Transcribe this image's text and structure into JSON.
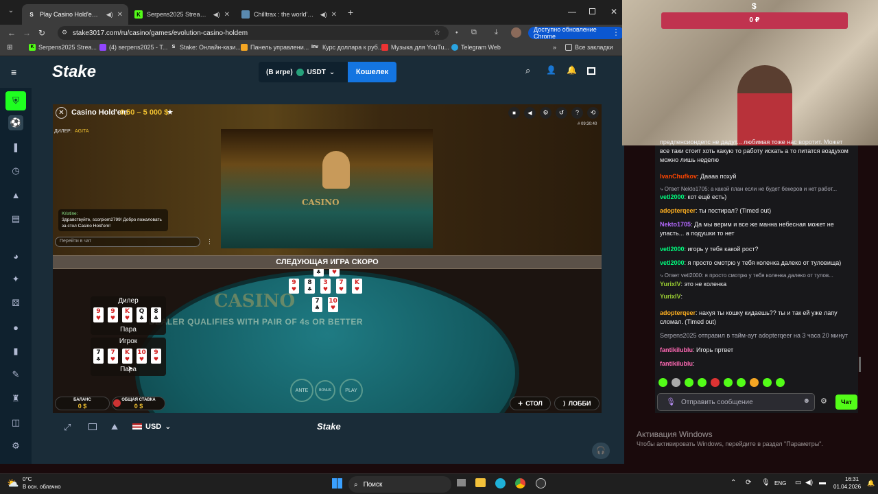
{
  "browser": {
    "tabs": [
      {
        "title": "Play Casino Hold'em by Evo",
        "active": true
      },
      {
        "title": "Serpens2025 Stream - Watch L",
        "active": false
      },
      {
        "title": "Chilltrax : the world's chillo",
        "active": false
      }
    ],
    "url": "stake3017.com/ru/casino/games/evolution-casino-holdem",
    "update_label": "Доступно обновление Chrome",
    "bookmarks": [
      "Serpens2025 Strea...",
      "(4) serpens2025 - T...",
      "Stake: Онлайн-кази...",
      "Панель управлени...",
      "Курс доллара к руб...",
      "Музыка для YouTu...",
      "Telegram Web"
    ],
    "all_bookmarks": "Все закладки"
  },
  "stake": {
    "logo": "Stake",
    "in_game": "(В игре)",
    "currency": "USDT",
    "wallet_label": "Кошелек"
  },
  "game": {
    "title": "Casino Hold'em",
    "limits": "0,50 – 5 000 $",
    "time": "# 09:30:40",
    "dealer_label": "ДИЛЕР:",
    "dealer_name": "AGITA",
    "chat_user": "Kristine:",
    "chat_msg": "Здравствуйте, scorpiom2799! Добро пожаловать за стол Casino Hold'em!",
    "chat_placeholder": "Перейти в чат",
    "next_game": "СЛЕДУЮЩАЯ ИГРА СКОРО",
    "felt_brand": "CASINO",
    "felt_text": "DEALER QUALIFIES WITH PAIR OF 4s OR BETTER",
    "dealer_hand_label": "Дилер",
    "dealer_result": "Пара",
    "player_hand_label": "Игрок",
    "player_result": "Пара",
    "ante": "ANTE",
    "bonus": "BONUS",
    "play": "PLAY",
    "balance_label": "БАЛАНС",
    "balance_value": "0 $",
    "total_bet_label": "ОБЩАЯ СТАВКА",
    "total_bet_value": "0 $",
    "table_btn": "СТОЛ",
    "lobby_btn": "ЛОББИ",
    "currency_select": "USD",
    "footer_logo": "Stake"
  },
  "colors": {
    "accent_blue": "#1475e1",
    "stake_bg": "#1a2c38",
    "sidebar_bg": "#0f212e",
    "green": "#1fff20",
    "twitch_purple": "#9146ff"
  },
  "overlay": {
    "currency_sign": "$",
    "balance": "0 ₽"
  },
  "twitch_chat": {
    "messages": [
      {
        "user": "",
        "text": "предпенсиондепс не дадут... любимая тоже нас воротит. Может все таки стоит хоть какую то работу искать а то питатся воздухом можно лишь неделю",
        "color": "#efeff1"
      },
      {
        "user": "IvanChufkov",
        "text": ": Даааа похуй",
        "color": "#ff4500"
      },
      {
        "user": "",
        "reply": "Ответ Nekto1705: а какой план если не будет бекеров и нет работ...",
        "color": "#adadb8"
      },
      {
        "user": "vetl2000",
        "text": ": кот ещё есть)",
        "color": "#00ff7f"
      },
      {
        "user": "adopterqeer",
        "text": ": ты постирал? (Timed out)",
        "color": "#ffb020"
      },
      {
        "user": "Nekto1705",
        "text": ": Да мы верим и все же манна небесная может не упасть... а подушки то нет",
        "color": "#b469ff"
      },
      {
        "user": "vetl2000",
        "text": ": игорь у тебя какой рост?",
        "color": "#00ff7f"
      },
      {
        "user": "vetl2000",
        "text": ": я просто смотрю у тебя коленка далеко от туловища)",
        "color": "#00ff7f"
      },
      {
        "user": "",
        "reply": "Ответ vetl2000: я просто смотрю у тебя коленка далеко от тулов...",
        "color": "#adadb8"
      },
      {
        "user": "YurixIV",
        "text": ": это не коленка",
        "color": "#9acd32"
      },
      {
        "user": "YurixIV",
        "text": ":",
        "color": "#9acd32"
      },
      {
        "user": "adopterqeer",
        "text": ": нахуя ты кошку кидаешь?? ты и так ей уже лапу сломал. (Timed out)",
        "color": "#ffb020"
      },
      {
        "user": "",
        "text": "Serpens2025 отправил в тайм-аут adopterqeer на 3 часа 20 минут",
        "color": "#adadb8"
      },
      {
        "user": "fantikilublu",
        "text": ": Игорь пртвет",
        "color": "#ff69b4"
      },
      {
        "user": "fantikilublu",
        "text": ":",
        "color": "#ff69b4"
      }
    ],
    "input_placeholder": "Отправить сообщение",
    "chat_button": "Чат"
  },
  "windows": {
    "activate_title": "Активация Windows",
    "activate_text": "Чтобы активировать Windows, перейдите в раздел \"Параметры\".",
    "weather_temp": "0°C",
    "weather_desc": "В осн. облачно",
    "search": "Поиск",
    "lang": "ENG",
    "time": "16:31",
    "date": "01.04.2026"
  }
}
